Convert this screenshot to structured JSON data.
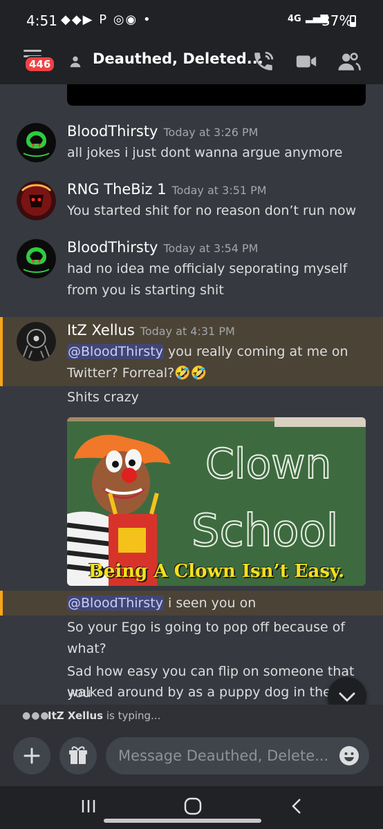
{
  "status_bar": {
    "time": "4:51",
    "notification_icons": "◆◆▶ P ◎◉ •",
    "network": "4G",
    "battery": "37%"
  },
  "header": {
    "unread_badge": "446",
    "title": "Deauthed, Deleted..."
  },
  "messages": [
    {
      "author": "BloodThirsty",
      "timestamp": "Today at 3:26 PM",
      "lines": [
        "all jokes i just dont wanna argue anymore"
      ]
    },
    {
      "author": "RNG TheBiz 1",
      "timestamp": "Today at 3:51 PM",
      "lines": [
        "You started shit for no reason don’t run now"
      ]
    },
    {
      "author": "BloodThirsty",
      "timestamp": "Today at 3:54 PM",
      "lines": [
        "had no idea me officialy seporating myself",
        "from you is starting shit"
      ]
    },
    {
      "author": "ItZ Xellus",
      "timestamp": "Today at 4:31 PM",
      "mention": "@BloodThirsty",
      "line1_rest": " you really coming at me on",
      "line2": "Twitter? Forreal?🤣🤣",
      "followup": "Shits crazy"
    }
  ],
  "image": {
    "board_text_1": "Clown",
    "board_text_2": "School",
    "caption": "Being A Clown Isn’t Easy."
  },
  "reply": {
    "mention": "@BloodThirsty",
    "rest": " i seen you on",
    "line2": "So your Ego is going to pop off because of",
    "line3": "what?",
    "line4": "Sad how easy you can flip on someone that you",
    "line5": "walked around by as a puppy dog in there"
  },
  "typing": {
    "user": "ItZ Xellus",
    "suffix": " is typing..."
  },
  "composer": {
    "placeholder": "Message Deauthed, Delete..."
  },
  "colors": {
    "background": "#36393f",
    "highlight": "#4b4336",
    "highlight_bar": "#faa61a",
    "mention_bg": "#414675",
    "badge": "#ed4245"
  }
}
